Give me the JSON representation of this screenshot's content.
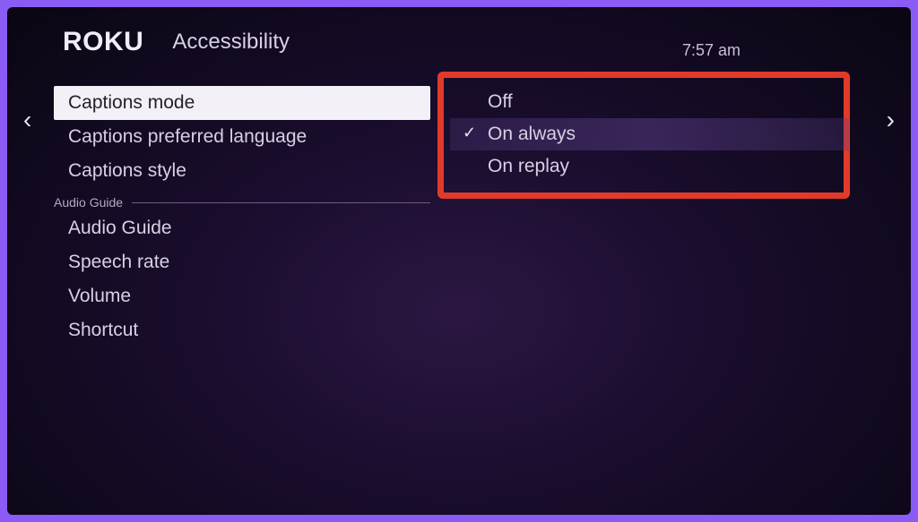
{
  "header": {
    "logo": "Roku",
    "title": "Accessibility",
    "time": "7:57  am"
  },
  "menu": {
    "items": [
      {
        "label": "Captions mode",
        "selected": true
      },
      {
        "label": "Captions preferred language",
        "selected": false
      },
      {
        "label": "Captions style",
        "selected": false
      }
    ],
    "section_label": "Audio Guide",
    "audio_items": [
      {
        "label": "Audio Guide"
      },
      {
        "label": "Speech rate"
      },
      {
        "label": "Volume"
      },
      {
        "label": "Shortcut"
      }
    ]
  },
  "options": [
    {
      "label": "Off",
      "checked": false
    },
    {
      "label": "On always",
      "checked": true
    },
    {
      "label": "On replay",
      "checked": false
    }
  ]
}
